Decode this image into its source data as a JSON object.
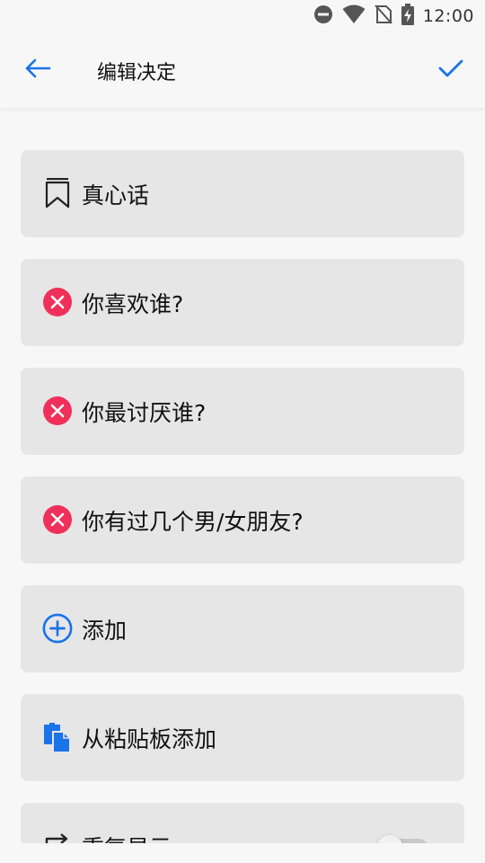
{
  "status_bar": {
    "time": "12:00",
    "icons": [
      "do-not-disturb-icon",
      "wifi-icon",
      "no-sim-icon",
      "battery-charging-icon"
    ]
  },
  "app_bar": {
    "title": "编辑决定",
    "back_icon": "arrow-left-icon",
    "confirm_icon": "checkmark-icon"
  },
  "colors": {
    "accent": "#1a73e8",
    "delete": "#f0305a",
    "card_bg": "#e6e6e6",
    "page_bg": "#f7f7f7"
  },
  "items": [
    {
      "label": "真心话",
      "icon": "bookmark-icon"
    },
    {
      "label": "你喜欢谁?",
      "icon": "delete-circle-icon"
    },
    {
      "label": "你最讨厌谁?",
      "icon": "delete-circle-icon"
    },
    {
      "label": "你有过几个男/女朋友?",
      "icon": "delete-circle-icon"
    },
    {
      "label": "添加",
      "icon": "add-circle-icon"
    },
    {
      "label": "从粘贴板添加",
      "icon": "clipboard-icon"
    },
    {
      "label": "重复显示",
      "icon": "repeat-icon",
      "toggle": false
    }
  ]
}
